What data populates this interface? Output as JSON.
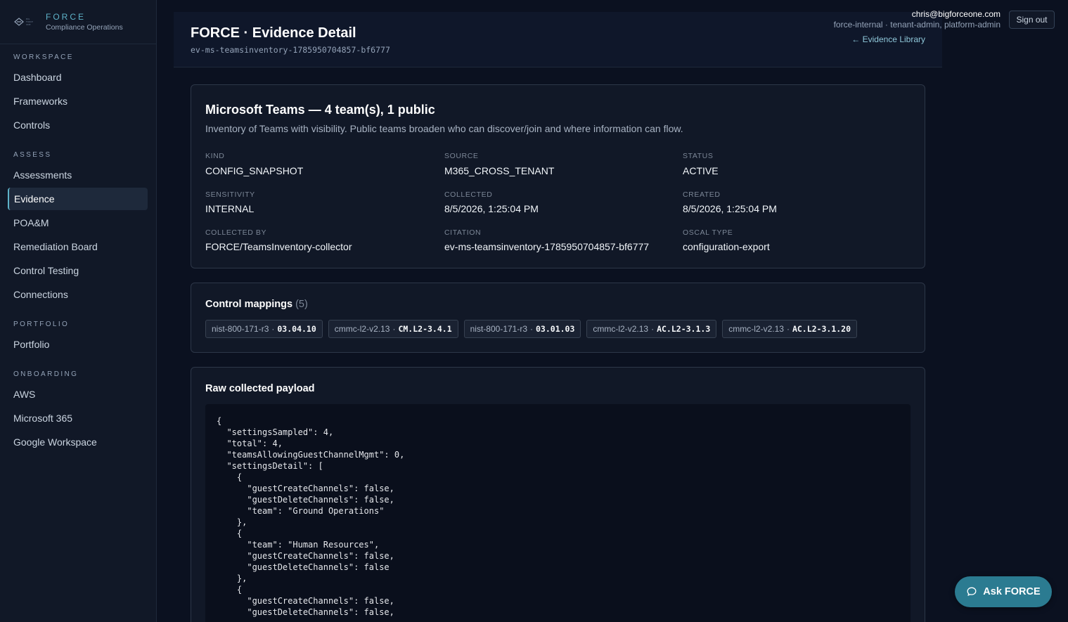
{
  "brand": {
    "name": "FORCE",
    "subtitle": "Compliance Operations"
  },
  "sidebar": {
    "sections": [
      {
        "label": "WORKSPACE",
        "items": [
          "Dashboard",
          "Frameworks",
          "Controls"
        ]
      },
      {
        "label": "ASSESS",
        "items": [
          "Assessments",
          "Evidence",
          "POA&M",
          "Remediation Board",
          "Control Testing",
          "Connections"
        ]
      },
      {
        "label": "PORTFOLIO",
        "items": [
          "Portfolio"
        ]
      },
      {
        "label": "ONBOARDING",
        "items": [
          "AWS",
          "Microsoft 365",
          "Google Workspace"
        ]
      }
    ],
    "active": "Evidence"
  },
  "header": {
    "title": "FORCE · Evidence Detail",
    "subtitle": "ev-ms-teamsinventory-1785950704857-bf6777",
    "back_link": "← Evidence Library"
  },
  "user": {
    "email": "chris@bigforceone.com",
    "roles": "force-internal · tenant-admin, platform-admin",
    "signout": "Sign out"
  },
  "evidence": {
    "title": "Microsoft Teams — 4 team(s), 1 public",
    "description": "Inventory of Teams with visibility. Public teams broaden who can discover/join and where information can flow.",
    "fields": [
      {
        "label": "KIND",
        "value": "CONFIG_SNAPSHOT"
      },
      {
        "label": "SOURCE",
        "value": "M365_CROSS_TENANT"
      },
      {
        "label": "STATUS",
        "value": "ACTIVE"
      },
      {
        "label": "SENSITIVITY",
        "value": "INTERNAL"
      },
      {
        "label": "COLLECTED",
        "value": "8/5/2026, 1:25:04 PM"
      },
      {
        "label": "CREATED",
        "value": "8/5/2026, 1:25:04 PM"
      },
      {
        "label": "COLLECTED BY",
        "value": "FORCE/TeamsInventory-collector"
      },
      {
        "label": "CITATION",
        "value": "ev-ms-teamsinventory-1785950704857-bf6777"
      },
      {
        "label": "OSCAL TYPE",
        "value": "configuration-export"
      }
    ]
  },
  "mappings": {
    "title": "Control mappings",
    "count": "(5)",
    "separator": "·",
    "items": [
      {
        "framework": "nist-800-171-r3",
        "control": "03.04.10"
      },
      {
        "framework": "cmmc-l2-v2.13",
        "control": "CM.L2-3.4.1"
      },
      {
        "framework": "nist-800-171-r3",
        "control": "03.01.03"
      },
      {
        "framework": "cmmc-l2-v2.13",
        "control": "AC.L2-3.1.3"
      },
      {
        "framework": "cmmc-l2-v2.13",
        "control": "AC.L2-3.1.20"
      }
    ]
  },
  "payload": {
    "title": "Raw collected payload",
    "text": "{\n  \"settingsSampled\": 4,\n  \"total\": 4,\n  \"teamsAllowingGuestChannelMgmt\": 0,\n  \"settingsDetail\": [\n    {\n      \"guestCreateChannels\": false,\n      \"guestDeleteChannels\": false,\n      \"team\": \"Ground Operations\"\n    },\n    {\n      \"team\": \"Human Resources\",\n      \"guestCreateChannels\": false,\n      \"guestDeleteChannels\": false\n    },\n    {\n      \"guestCreateChannels\": false,\n      \"guestDeleteChannels\": false,"
  },
  "ask_button": "Ask FORCE",
  "colors": {
    "accent": "#5eb3c9",
    "background": "#0b1120",
    "card": "#111827",
    "ask": "#2b7b91"
  },
  "icons": {
    "chat": "chat-bubble-icon",
    "back": "arrow-left-icon",
    "logo": "force-logo-icon"
  }
}
